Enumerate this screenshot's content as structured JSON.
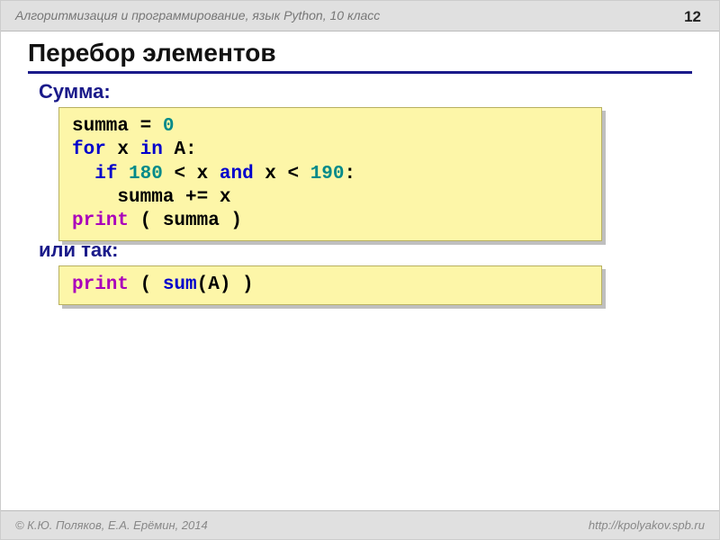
{
  "header": {
    "course": "Алгоритмизация и программирование, язык Python, 10 класс",
    "page": "12"
  },
  "title": "Перебор элементов",
  "subtitle1": "Сумма:",
  "subtitle2": "или так:",
  "code1": {
    "l1_a": "summa = ",
    "l1_num0": "0",
    "l2_for": "for",
    "l2_mid": " x ",
    "l2_in": "in",
    "l2_end": " A:",
    "l3_pad": "  ",
    "l3_if": "if",
    "l3_sp": " ",
    "l3_n180": "180",
    "l3_mid1": " < x ",
    "l3_and": "and",
    "l3_mid2": " x < ",
    "l3_n190": "190",
    "l3_colon": ":",
    "l4": "    summa += x",
    "l5_print": "print",
    "l5_rest": " ( summa )"
  },
  "code2": {
    "l1_print": "print",
    "l1_mid1": " ( ",
    "l1_sum": "sum",
    "l1_mid2": "(A) )"
  },
  "footer": {
    "left": "© К.Ю. Поляков, Е.А. Ерёмин, 2014",
    "right": "http://kpolyakov.spb.ru"
  }
}
